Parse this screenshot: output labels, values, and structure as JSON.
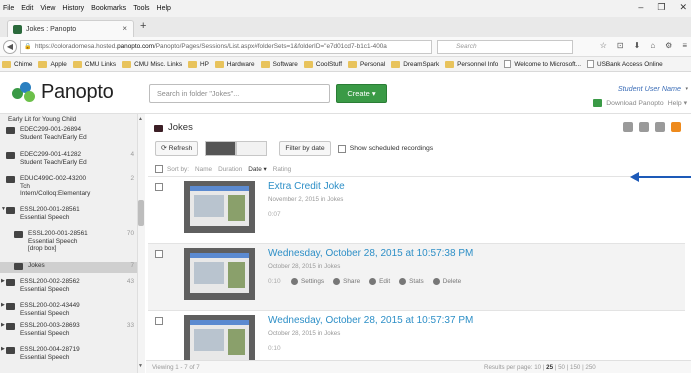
{
  "menu": [
    "File",
    "Edit",
    "View",
    "History",
    "Bookmarks",
    "Tools",
    "Help"
  ],
  "window_controls": [
    "–",
    "❐",
    "✕"
  ],
  "tab": {
    "title": "Jokes : Panopto",
    "close": "×",
    "new": "+"
  },
  "address": {
    "url_prefix": "https://coloradomesa.hosted.",
    "url_domain": "panopto.com",
    "url_path": "/Panopto/Pages/Sessions/List.aspx#folderSets=1&folderID=\"e7d01cd7-b1c1-400a",
    "search_placeholder": "Search"
  },
  "nav_icons": [
    "☆",
    "⊡",
    "⬇",
    "⌂",
    "⚙",
    "≡"
  ],
  "bookmarks": [
    {
      "label": "Chime",
      "type": "folder"
    },
    {
      "label": "Apple",
      "type": "folder"
    },
    {
      "label": "CMU Links",
      "type": "folder"
    },
    {
      "label": "CMU Misc. Links",
      "type": "folder"
    },
    {
      "label": "HP",
      "type": "folder"
    },
    {
      "label": "Hardware",
      "type": "folder"
    },
    {
      "label": "Software",
      "type": "folder"
    },
    {
      "label": "CoolStuff",
      "type": "folder"
    },
    {
      "label": "Personal",
      "type": "folder"
    },
    {
      "label": "DreamSpark",
      "type": "folder"
    },
    {
      "label": "Personnel Info",
      "type": "folder"
    },
    {
      "label": "Welcome to Microsoft...",
      "type": "page"
    },
    {
      "label": "USBank Access Online",
      "type": "page"
    }
  ],
  "header": {
    "logo": "Panopto",
    "search_placeholder": "Search in folder \"Jokes\"...",
    "create_label": "Create ▾",
    "user_name": "Student User Name",
    "download_label": "Download Panopto",
    "help_label": "Help ▾"
  },
  "sidebar": {
    "items": [
      {
        "lines": [
          "Early Lit for Young Child"
        ],
        "count": "",
        "selected": false,
        "expanded": false
      },
      {
        "lines": [
          "EDEC299-001-26894",
          "Student Teach/Early Ed"
        ],
        "count": "",
        "selected": false,
        "expanded": false
      },
      {
        "lines": [
          "EDEC299-001-41282",
          "Student Teach/Early Ed"
        ],
        "count": "4",
        "selected": false,
        "expanded": false
      },
      {
        "lines": [
          "EDUC499C-002-43200",
          "Tch",
          "Intern/Colloq:Elementary"
        ],
        "count": "2",
        "selected": false,
        "expanded": false
      },
      {
        "lines": [
          "ESSL200-001-28561",
          "Essential Speech"
        ],
        "count": "",
        "selected": false,
        "expanded": true
      },
      {
        "lines": [
          "ESSL200-001-28561",
          "Essential Speech",
          "[drop box]"
        ],
        "count": "70",
        "selected": false,
        "expanded": false
      },
      {
        "lines": [
          "Jokes"
        ],
        "count": "7",
        "selected": true,
        "expanded": false
      },
      {
        "lines": [
          "ESSL200-002-28562",
          "Essential Speech"
        ],
        "count": "43",
        "selected": false,
        "expanded": false
      },
      {
        "lines": [
          "ESSL200-002-43449",
          "Essential Speech"
        ],
        "count": "",
        "selected": false,
        "expanded": false
      },
      {
        "lines": [
          "ESSL200-003-28693",
          "Essential Speech"
        ],
        "count": "33",
        "selected": false,
        "expanded": false
      },
      {
        "lines": [
          "ESSL200-004-28719",
          "Essential Speech"
        ],
        "count": "",
        "selected": false,
        "expanded": false
      }
    ]
  },
  "folder": {
    "title": "Jokes",
    "refresh_label": "Refresh",
    "filter_label": "Filter by date",
    "scheduled_label": "Show scheduled recordings",
    "sort_label": "Sort by:",
    "sort_options": [
      "Name",
      "Duration",
      "Date ▾",
      "Rating"
    ]
  },
  "sessions": [
    {
      "title": "Extra Credit Joke",
      "date": "November 2, 2015",
      "folder": "Jokes",
      "duration": "0:07",
      "show_actions": false
    },
    {
      "title": "Wednesday, October 28, 2015 at 10:57:38 PM",
      "date": "October 28, 2015",
      "folder": "Jokes",
      "duration": "0:10",
      "show_actions": true
    },
    {
      "title": "Wednesday, October 28, 2015 at 10:57:37 PM",
      "date": "October 28, 2015",
      "folder": "Jokes",
      "duration": "0:10",
      "show_actions": false
    }
  ],
  "row_actions": [
    "Settings",
    "Share",
    "Edit",
    "Stats",
    "Delete"
  ],
  "in_word": "in",
  "footer": {
    "viewing": "Viewing 1 - 7 of 7",
    "per_page_label": "Results per page:",
    "per_page_options": [
      "10",
      "25",
      "50",
      "150",
      "250"
    ],
    "per_page_selected": "25"
  },
  "colors": {
    "accent_green": "#3a9a46",
    "link_blue": "#2d8fc7",
    "annotation_arrow": "#1d5ab8",
    "rss_orange": "#ee8a1c"
  }
}
